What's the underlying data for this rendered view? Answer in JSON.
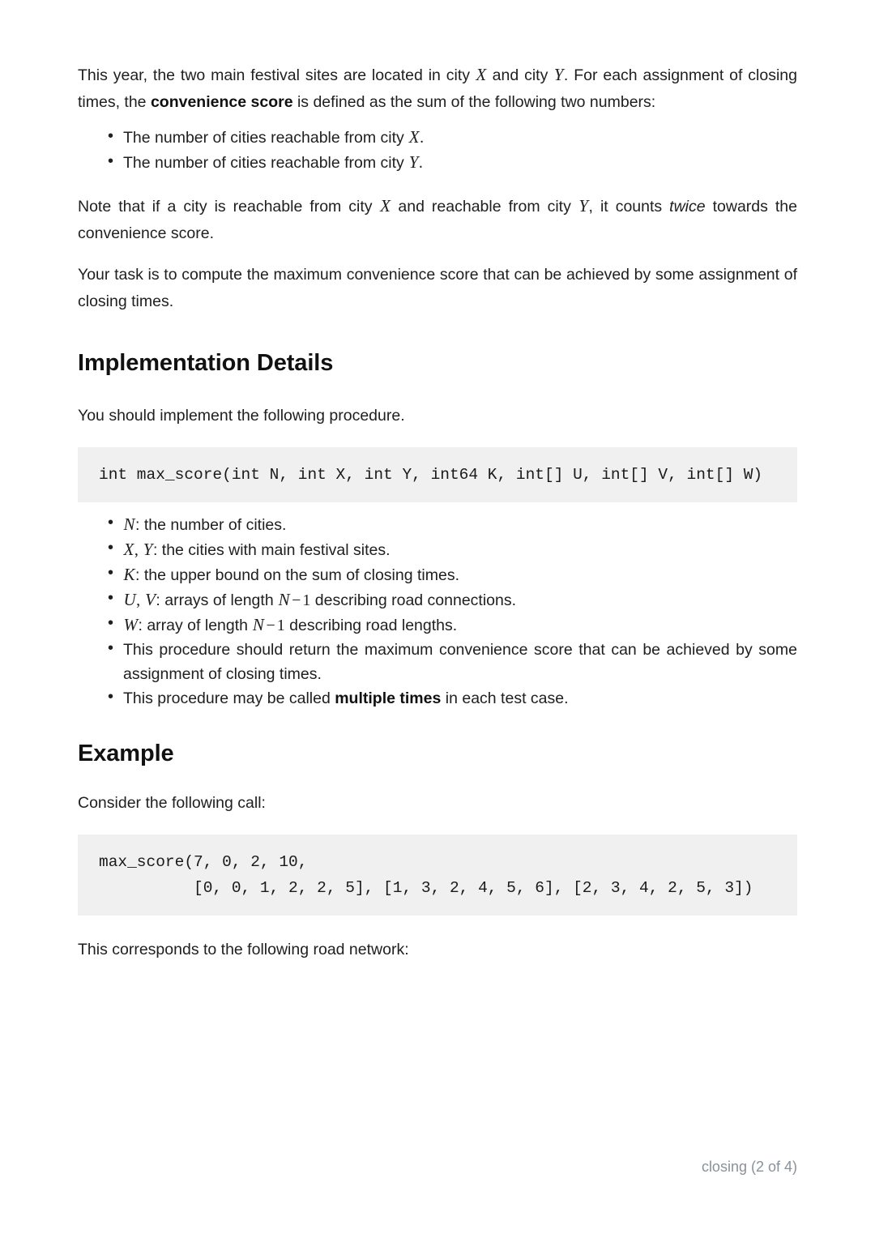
{
  "document": {
    "intro_paragraph": {
      "seg1": "This year, the two main festival sites are located in city ",
      "var_x": "X",
      "seg2": " and city ",
      "var_y": "Y",
      "seg3": ". For each assignment of closing times, the ",
      "bold_term": "convenience score",
      "seg4": " is defined as the sum of the following two numbers:"
    },
    "reach_bullets": [
      {
        "prefix": "The number of cities reachable from city ",
        "var": "X",
        "suffix": "."
      },
      {
        "prefix": "The number of cities reachable from city ",
        "var": "Y",
        "suffix": "."
      }
    ],
    "note_paragraph": {
      "seg1": "Note that if a city is reachable from city ",
      "var_x": "X",
      "seg2": " and reachable from city ",
      "var_y": "Y",
      "seg3": ", it counts ",
      "italic_term": "twice",
      "seg4": " towards the convenience score."
    },
    "task_paragraph": "Your task is to compute the maximum convenience score that can be achieved by some assignment of closing times.",
    "implementation": {
      "heading": "Implementation Details",
      "lead_in": "You should implement the following procedure.",
      "signature": "int max_score(int N, int X, int Y, int64 K, int[] U, int[] V, int[] W)",
      "params": [
        {
          "var": "N",
          "text": ": the number of cities."
        },
        {
          "var": "X",
          "var2": "Y",
          "text": ": the cities with main festival sites."
        },
        {
          "var": "K",
          "text": ": the upper bound on the sum of closing times."
        },
        {
          "var": "U",
          "var2": "V",
          "text_pre": ": arrays of length ",
          "math_var": "N",
          "math_op": "−",
          "math_num": "1",
          "text_post": " describing road connections."
        },
        {
          "var": "W",
          "text_pre": ": array of length ",
          "math_var": "N",
          "math_op": "−",
          "math_num": "1",
          "text_post": " describing road lengths."
        }
      ],
      "note_return": "This procedure should return the maximum convenience score that can be achieved by some assignment of closing times.",
      "note_multi": {
        "pre": "This procedure may be called ",
        "bold": "multiple times",
        "post": " in each test case."
      }
    },
    "example": {
      "heading": "Example",
      "lead_in": "Consider the following call:",
      "call_line1": "max_score(7, 0, 2, 10,",
      "call_line2": "          [0, 0, 1, 2, 2, 5], [1, 3, 2, 4, 5, 6], [2, 3, 4, 2, 5, 3])",
      "closing_line": "This corresponds to the following road network:"
    },
    "footer": "closing (2 of 4)"
  }
}
